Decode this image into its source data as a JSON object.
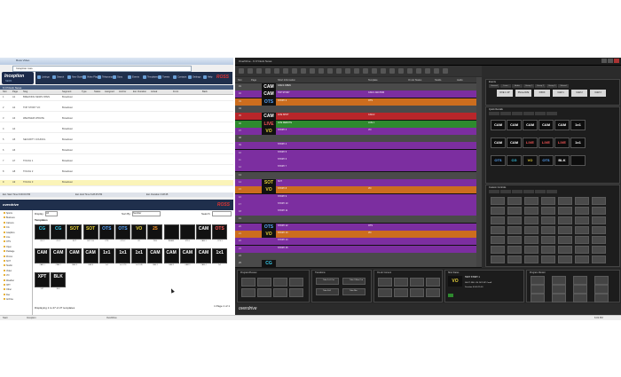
{
  "browser": {
    "tab_title": "Ross Video",
    "address": "Inception.ross",
    "app_logo": "Inception",
    "app_logo_sub": "NEWS",
    "brand": "ROSS",
    "toolbar": [
      "Listings",
      "Search",
      "New Stories",
      "Video Player",
      "Teleprompter",
      "Story",
      "Events",
      "Templates",
      "Tweets",
      "Contacts",
      "Settings",
      "Help"
    ]
  },
  "rundown_panel": {
    "header": "6 O'Clock News",
    "columns": [
      "Slot",
      "Page",
      "Slug",
      "Segment",
      "Type",
      "Status",
      "Assigned",
      "Anchor",
      "Est. Duration",
      "Actual",
      "Front",
      "Back"
    ],
    "rows": [
      {
        "slot": "1",
        "page": "A1",
        "slug": "BREAKING NEWS OPEN",
        "type": "Broadcast"
      },
      {
        "slot": "2",
        "page": "A2",
        "slug": "TOP STORY VO",
        "type": "Broadcast"
      },
      {
        "slot": "3",
        "page": "A3",
        "slug": "WEATHER UPDATE",
        "type": "Broadcast"
      },
      {
        "slot": "4",
        "page": "A4",
        "slug": "",
        "type": "Broadcast"
      },
      {
        "slot": "5",
        "page": "A5",
        "slug": "SECURITY COUNCIL",
        "type": "Broadcast"
      },
      {
        "slot": "6",
        "page": "A6",
        "slug": "",
        "type": "Broadcast"
      },
      {
        "slot": "7",
        "page": "A7",
        "slug": "TOUCH 1",
        "type": "Broadcast"
      },
      {
        "slot": "8",
        "page": "A8",
        "slug": "TOUCH 2",
        "type": "Broadcast"
      },
      {
        "slot": "9",
        "page": "A9",
        "slug": "TOUCH 3",
        "type": "Broadcast"
      }
    ],
    "status": [
      "Est. Start Time 6:00:00 PM",
      "Est. End Time 6:28:45 PM",
      "Est. Duration 0:28:45"
    ]
  },
  "template_panel": {
    "app": "overdrive",
    "brand": "ROSS",
    "display_label": "Display",
    "display_value": "All",
    "sort_label": "Sort By",
    "sort_value": "Number",
    "search_label": "Search",
    "templates_label": "Templates",
    "folders": [
      "Sports",
      "Business",
      "Camera",
      "CG",
      "Graphics",
      "Live",
      "OTS",
      "Open",
      "Package",
      "Promo",
      "SOT",
      "Studio",
      "Video",
      "VO",
      "Weather",
      "XPT",
      "Other",
      "Dev",
      "Archive"
    ],
    "tiles": [
      {
        "n": "CG",
        "c": "#36c9ea",
        "l": "CG 1"
      },
      {
        "n": "CG",
        "c": "#36c9ea",
        "l": "CG 2"
      },
      {
        "n": "SOT",
        "c": "#e8d23a",
        "l": "SOT"
      },
      {
        "n": "SOT",
        "c": "#e8d23a",
        "l": "SOT CG"
      },
      {
        "n": "OTS",
        "c": "#5aa8ff",
        "l": "OTS"
      },
      {
        "n": "OTS",
        "c": "#5aa8ff",
        "l": "OTS 2"
      },
      {
        "n": "VO",
        "c": "#e8d23a",
        "l": "VO"
      },
      {
        "n": "25",
        "c": "#ff9a2a",
        "l": "PKG"
      },
      {
        "n": "",
        "c": "#8ad",
        "l": "BLANK"
      },
      {
        "n": "",
        "c": "#eee",
        "l": "STILL"
      },
      {
        "n": "CAM",
        "c": "#ffffff",
        "l": "CAM 3"
      },
      {
        "n": "OTS",
        "c": "#ff5a5a",
        "l": "OTS 3"
      },
      {
        "n": "CAM",
        "c": "#ffffff",
        "l": "CAM 1"
      },
      {
        "n": "CAM",
        "c": "#ffffff",
        "l": "CAM 2"
      },
      {
        "n": "CAM",
        "c": "#ffffff",
        "l": "CAM 3"
      },
      {
        "n": "CAM",
        "c": "#ffffff",
        "l": "CAM 4"
      },
      {
        "n": "1x1",
        "c": "#ffffff",
        "l": "1x1"
      },
      {
        "n": "1x1",
        "c": "#ffffff",
        "l": "1x1 OTS"
      },
      {
        "n": "1x1",
        "c": "#ffffff",
        "l": "1x1 LIVE"
      },
      {
        "n": "CAM",
        "c": "#ffffff",
        "l": "CAM 1"
      },
      {
        "n": "CAM",
        "c": "#ffffff",
        "l": "CAM 2"
      },
      {
        "n": "CAM",
        "c": "#ffffff",
        "l": "CAM 3"
      },
      {
        "n": "CAM",
        "c": "#ffffff",
        "l": "CAM 4"
      },
      {
        "n": "1x1",
        "c": "#ffffff",
        "l": "1x1"
      },
      {
        "n": "XPT",
        "c": "#ffffff",
        "l": "XPT"
      },
      {
        "n": "BLK",
        "c": "#ffffff",
        "l": "BLK"
      }
    ],
    "paging": "Displaying 1 to 27 of 27 templates",
    "pager": "1 Page 1 of 1"
  },
  "overdrive": {
    "window_title": "OverDrive - 6 O'Clock News",
    "rundown_columns": [
      "Slot",
      "Page",
      "Short Information",
      "Template",
      "On Air Status",
      "Studio",
      "Audio"
    ],
    "rows": [
      {
        "num": "01",
        "bg": "#4a4a4a",
        "gic": "CAM",
        "gc": "#ffffff",
        "txt": "CAM 4 OPEN",
        "txt2": ""
      },
      {
        "num": "02",
        "bg": "#7c2ea0",
        "gic": "CAM",
        "gc": "#ffffff",
        "txt": "TOP STORY",
        "txt2": "CAM 1 ANCHOR"
      },
      {
        "num": "03",
        "bg": "#cc6d1e",
        "gic": "OTS",
        "gc": "#5aa8ff",
        "txt": "STORY 2",
        "txt2": "OTS"
      },
      {
        "num": "04",
        "bg": "#4a4a4a",
        "gic": "",
        "gc": "#fff",
        "txt": "",
        "txt2": ""
      },
      {
        "num": "05",
        "bg": "#b8262a",
        "gic": "CAM",
        "gc": "#ffffff",
        "txt": "LIVE SHOT",
        "txt2": "CAM 2"
      },
      {
        "num": "06",
        "bg": "#2e8a2e",
        "gic": "LIVE",
        "gc": "#ff5a5a",
        "txt": "LIVE REMOTE",
        "txt2": "LIVE 1"
      },
      {
        "num": "07",
        "bg": "#7c2ea0",
        "gic": "VO",
        "gc": "#e8d23a",
        "txt": "STORY 3",
        "txt2": "VO"
      },
      {
        "num": "08",
        "bg": "#4a4a4a",
        "gic": "",
        "gc": "#fff",
        "txt": "",
        "txt2": ""
      },
      {
        "num": "09",
        "bg": "#7c2ea0",
        "gic": "",
        "gc": "#fff",
        "txt": "STORY 4",
        "txt2": ""
      },
      {
        "num": "10",
        "bg": "#7c2ea0",
        "gic": "",
        "gc": "#fff",
        "txt": "STORY 5",
        "txt2": ""
      },
      {
        "num": "11",
        "bg": "#7c2ea0",
        "gic": "",
        "gc": "#fff",
        "txt": "STORY 6",
        "txt2": ""
      },
      {
        "num": "12",
        "bg": "#7c2ea0",
        "gic": "",
        "gc": "#fff",
        "txt": "STORY 7",
        "txt2": ""
      },
      {
        "num": "13",
        "bg": "#4a4a4a",
        "gic": "",
        "gc": "#fff",
        "txt": "",
        "txt2": ""
      },
      {
        "num": "14",
        "bg": "#7c2ea0",
        "gic": "SOT",
        "gc": "#e8d23a",
        "txt": "SOT",
        "txt2": ""
      },
      {
        "num": "15",
        "bg": "#cc6d1e",
        "gic": "VO",
        "gc": "#e8d23a",
        "txt": "STORY 8",
        "txt2": "VO"
      },
      {
        "num": "16",
        "bg": "#7c2ea0",
        "gic": "",
        "gc": "#fff",
        "txt": "STORY 9",
        "txt2": ""
      },
      {
        "num": "17",
        "bg": "#7c2ea0",
        "gic": "",
        "gc": "#fff",
        "txt": "STORY 10",
        "txt2": ""
      },
      {
        "num": "18",
        "bg": "#7c2ea0",
        "gic": "",
        "gc": "#fff",
        "txt": "STORY 11",
        "txt2": ""
      },
      {
        "num": "19",
        "bg": "#4a4a4a",
        "gic": "",
        "gc": "#fff",
        "txt": "",
        "txt2": ""
      },
      {
        "num": "20",
        "bg": "#7c2ea0",
        "gic": "OTS",
        "gc": "#5aa8ff",
        "txt": "STORY 12",
        "txt2": "OTS"
      },
      {
        "num": "21",
        "bg": "#cc6d1e",
        "gic": "VO",
        "gc": "#e8d23a",
        "txt": "STORY 13",
        "txt2": "VO"
      },
      {
        "num": "22",
        "bg": "#7c2ea0",
        "gic": "",
        "gc": "#fff",
        "txt": "STORY 14",
        "txt2": ""
      },
      {
        "num": "23",
        "bg": "#7c2ea0",
        "gic": "",
        "gc": "#fff",
        "txt": "STORY 15",
        "txt2": ""
      },
      {
        "num": "24",
        "bg": "#4a4a4a",
        "gic": "",
        "gc": "#fff",
        "txt": "",
        "txt2": ""
      },
      {
        "num": "25",
        "bg": "#4a4a4a",
        "gic": "CG",
        "gc": "#36c9ea",
        "txt": "",
        "txt2": ""
      }
    ],
    "events_header": "Events",
    "events_tabs": [
      "General",
      "Lines",
      "Audio",
      "Group 1",
      "Group 2",
      "Group 3",
      "Shared"
    ],
    "event_buttons": [
      "DVE 1 UP",
      "Phone DVE",
      "3 BOX",
      "CAM 1",
      "CAM 2",
      "CAM 3",
      "DVE 2",
      "OTS 2",
      "DVE 3",
      "SWAP",
      "LOGO",
      "OTS 3"
    ],
    "quick_header": "Quick Recalls",
    "quick_tiles": [
      {
        "n": "CAM",
        "c": "#ffffff"
      },
      {
        "n": "CAM",
        "c": "#ffffff"
      },
      {
        "n": "CAM",
        "c": "#ffffff"
      },
      {
        "n": "CAM",
        "c": "#ffffff"
      },
      {
        "n": "CAM",
        "c": "#ffffff"
      },
      {
        "n": "1x1",
        "c": "#ffffff"
      },
      {
        "n": "CAM",
        "c": "#ffffff"
      },
      {
        "n": "CAM",
        "c": "#ffffff"
      },
      {
        "n": "LIVE",
        "c": "#ff5a5a"
      },
      {
        "n": "LIVE",
        "c": "#ff5a5a"
      },
      {
        "n": "LIVE",
        "c": "#ff5a5a"
      },
      {
        "n": "1x1",
        "c": "#ffffff"
      },
      {
        "n": "OTS",
        "c": "#5aa8ff"
      },
      {
        "n": "CG",
        "c": "#36c9ea"
      },
      {
        "n": "VO",
        "c": "#e8d23a"
      },
      {
        "n": "OTS",
        "c": "#5aa8ff"
      },
      {
        "n": "BLK",
        "c": "#ffffff"
      },
      {
        "n": "",
        "c": "#fff"
      }
    ],
    "custom_header": "Custom Controls",
    "custom_buttons": [
      "CAM 1",
      "CAM 2",
      "CAM 3",
      "CAM 4",
      "PROMPT",
      "LOGO",
      "PREV",
      "NEXT",
      "PLAY",
      "STOP",
      "CUE",
      "HOME",
      "KEY 1",
      "KEY 2",
      "DSK 1",
      "DSK 2",
      "AUTO",
      "CUT"
    ],
    "bottom_sections": [
      {
        "title": "Program/Preview"
      },
      {
        "title": "Transitions"
      },
      {
        "title": "On-Air Content"
      },
      {
        "title": "Shot Status"
      },
      {
        "title": "Program Monitor"
      }
    ],
    "transitions": [
      "Take 1x1 Cut",
      "Take 2-Box Cut",
      "Take Full",
      "Take Mix"
    ],
    "shot_status": {
      "gfx": "VO",
      "line1": "TEST STORY 1",
      "line2": "SHOT: REL LIS 2076 8P Cam8",
      "line3": "Duration 00:00:15:00"
    },
    "logo": "overdrive"
  },
  "taskbar": {
    "items": [
      "Start",
      "Inception",
      "OverDrive",
      "6:03 PM"
    ]
  }
}
